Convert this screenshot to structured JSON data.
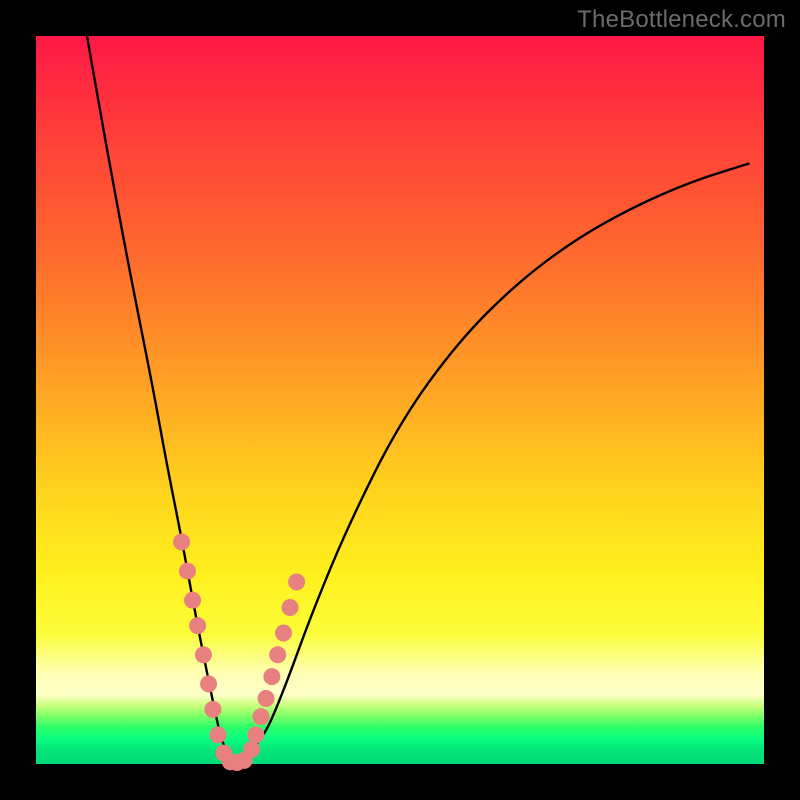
{
  "watermark": "TheBottleneck.com",
  "colors": {
    "frame": "#000000",
    "dot": "#e98080",
    "curve": "#000000"
  },
  "chart_data": {
    "type": "line",
    "title": "",
    "xlabel": "",
    "ylabel": "",
    "xlim": [
      0,
      100
    ],
    "ylim": [
      0,
      100
    ],
    "series": [
      {
        "name": "bottleneck-curve",
        "x": [
          7,
          10,
          13,
          16,
          18,
          20,
          22,
          24,
          25.5,
          27,
          31,
          34,
          38,
          43,
          50,
          58,
          66,
          74,
          82,
          90,
          98
        ],
        "y": [
          100,
          83,
          67,
          52,
          41,
          31,
          20,
          10,
          3,
          0,
          3,
          10,
          21,
          33,
          47,
          58,
          66,
          72,
          76.5,
          80,
          82.5
        ]
      }
    ],
    "markers": {
      "name": "highlighted-points",
      "x": [
        20.0,
        20.8,
        21.5,
        22.2,
        23.0,
        23.7,
        24.3,
        25.0,
        25.8,
        26.7,
        27.6,
        28.6,
        29.6,
        30.2,
        30.9,
        31.6,
        32.4,
        33.2,
        34.0,
        34.9,
        35.8
      ],
      "y": [
        30.5,
        26.5,
        22.5,
        19.0,
        15.0,
        11.0,
        7.5,
        4.0,
        1.5,
        0.3,
        0.2,
        0.5,
        2.0,
        4.0,
        6.5,
        9.0,
        12.0,
        15.0,
        18.0,
        21.5,
        25.0
      ]
    }
  }
}
